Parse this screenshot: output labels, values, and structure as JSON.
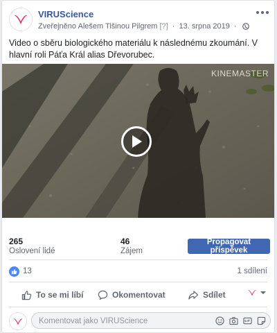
{
  "post": {
    "page_name": "VIRUScience",
    "published_by": "Zveřejněno Alešem Tišinou Pilgrem",
    "help_mark": "[?]",
    "dot": "·",
    "date": "13. srpna 2019",
    "text": "Video o sběru biologického materiálu k následnému zkoumání. V hlavní roli Páťa Král alias Dřevorubec."
  },
  "video": {
    "watermark": "KINEMASTER"
  },
  "stats": {
    "reach_value": "265",
    "reach_label": "Oslovení lidé",
    "engagement_value": "46",
    "engagement_label": "Zájem",
    "promote_label": "Propagovat příspěvek"
  },
  "reactions": {
    "likes": "13",
    "shares": "1 sdílení"
  },
  "actions": {
    "like": "To se mi líbí",
    "comment": "Okomentovat",
    "share": "Sdílet"
  },
  "comment": {
    "placeholder": "Komentovat jako VIRUScience"
  },
  "colors": {
    "brand_link": "#385898",
    "button_blue": "#4267b2",
    "like_blue": "#4b88f2",
    "logo_pink": "#e0336d"
  }
}
